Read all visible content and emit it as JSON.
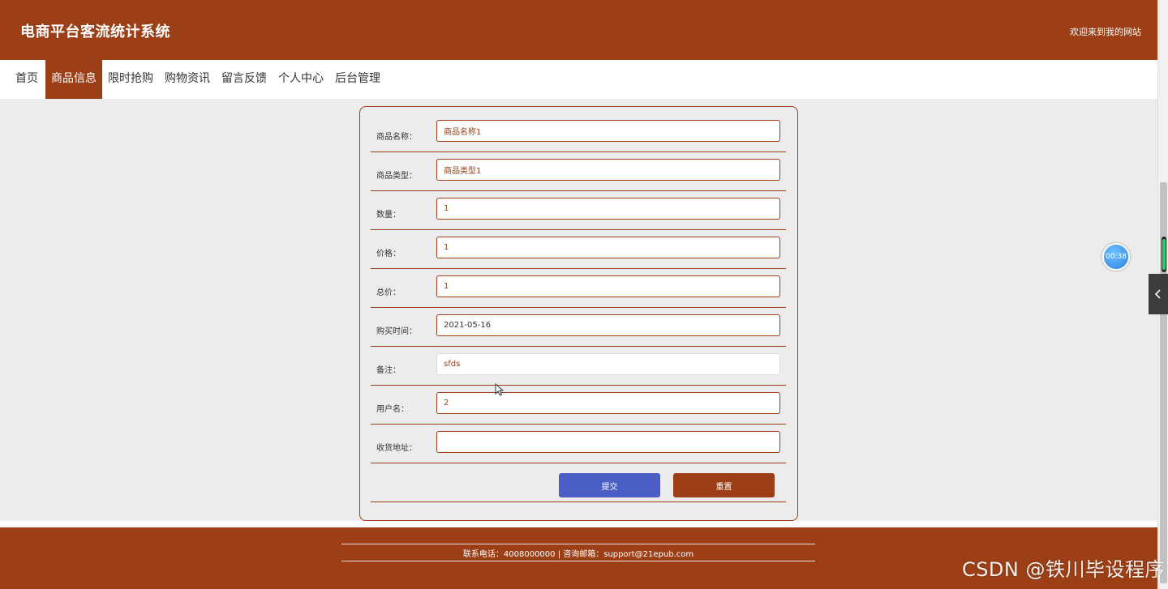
{
  "header": {
    "site_title": "电商平台客流统计系统",
    "welcome": "欢迎来到我的网站"
  },
  "nav": {
    "items": [
      {
        "label": "首页",
        "active": false
      },
      {
        "label": "商品信息",
        "active": true
      },
      {
        "label": "限时抢购",
        "active": false
      },
      {
        "label": "购物资讯",
        "active": false
      },
      {
        "label": "留言反馈",
        "active": false
      },
      {
        "label": "个人中心",
        "active": false
      },
      {
        "label": "后台管理",
        "active": false
      }
    ]
  },
  "form": {
    "fields": [
      {
        "label": "商品名称：",
        "value": "商品名称1"
      },
      {
        "label": "商品类型：",
        "value": "商品类型1"
      },
      {
        "label": "数量：",
        "value": "1"
      },
      {
        "label": "价格：",
        "value": "1"
      },
      {
        "label": "总价：",
        "value": "1"
      },
      {
        "label": "购买时间：",
        "value": "2021-05-16"
      },
      {
        "label": "备注：",
        "value": "sfds"
      },
      {
        "label": "用户名：",
        "value": "2"
      },
      {
        "label": "收货地址：",
        "value": ""
      }
    ],
    "submit_label": "提交",
    "reset_label": "重置"
  },
  "footer": {
    "contact": "联系电话：4008000000 | 咨询邮箱：support@21epub.com"
  },
  "overlay": {
    "timer": "00:38",
    "side_tab_icon": "chevron-left-icon",
    "watermark": "CSDN @铁川毕设程序"
  },
  "colors": {
    "brand": "#9c3f16",
    "submit": "#4a5ec6",
    "background": "#ececec"
  }
}
